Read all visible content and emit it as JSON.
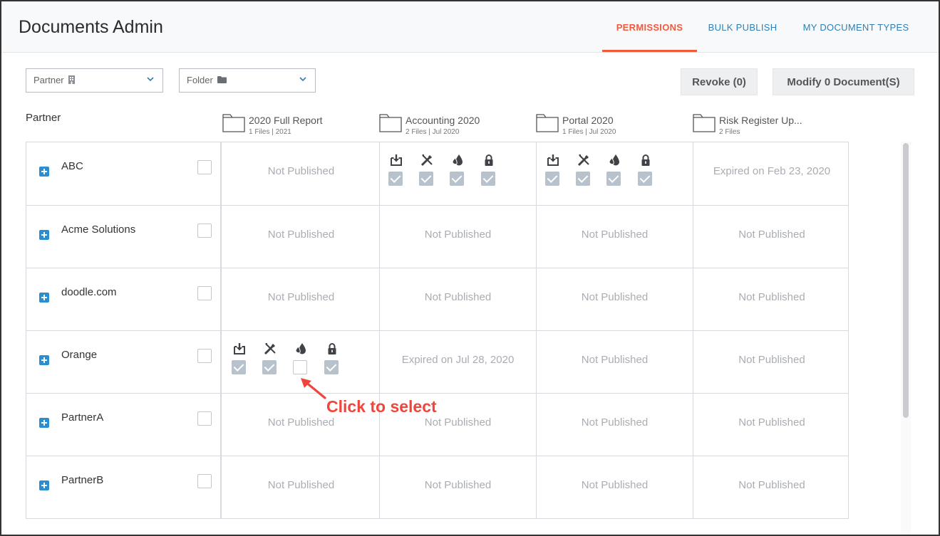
{
  "app": {
    "title": "Documents Admin"
  },
  "tabs": [
    {
      "label": "PERMISSIONS",
      "active": true
    },
    {
      "label": "BULK PUBLISH",
      "active": false
    },
    {
      "label": "MY DOCUMENT TYPES",
      "active": false
    }
  ],
  "filters": {
    "partner_label": "Partner",
    "partner_icon": "building-icon",
    "folder_label": "Folder",
    "folder_icon": "folder-icon"
  },
  "actions": {
    "revoke_label": "Revoke (0)",
    "modify_label": "Modify 0 Document(S)"
  },
  "grid": {
    "partner_header": "Partner",
    "columns": [
      {
        "name": "2020 Full Report",
        "sub": "1 Files | 2021"
      },
      {
        "name": "Accounting 2020",
        "sub": "2 Files | Jul 2020"
      },
      {
        "name": "Portal 2020",
        "sub": "1 Files | Jul 2020"
      },
      {
        "name": "Risk Register Up...",
        "sub": "2 Files"
      }
    ],
    "permission_icons": [
      "download-icon",
      "edit-tools-icon",
      "watermark-drop-icon",
      "lock-icon"
    ],
    "rows": [
      {
        "partner": "ABC",
        "cells": [
          {
            "status": "Not Published"
          },
          {
            "permissions": [
              true,
              true,
              true,
              true
            ]
          },
          {
            "permissions": [
              true,
              true,
              true,
              true
            ]
          },
          {
            "status": "Expired on Feb 23, 2020"
          }
        ]
      },
      {
        "partner": "Acme Solutions",
        "cells": [
          {
            "status": "Not Published"
          },
          {
            "status": "Not Published"
          },
          {
            "status": "Not Published"
          },
          {
            "status": "Not Published"
          }
        ]
      },
      {
        "partner": "doodle.com",
        "cells": [
          {
            "status": "Not Published"
          },
          {
            "status": "Not Published"
          },
          {
            "status": "Not Published"
          },
          {
            "status": "Not Published"
          }
        ]
      },
      {
        "partner": "Orange",
        "cells": [
          {
            "permissions": [
              true,
              true,
              false,
              true
            ]
          },
          {
            "status": "Expired on Jul 28, 2020"
          },
          {
            "status": "Not Published"
          },
          {
            "status": "Not Published"
          }
        ]
      },
      {
        "partner": "PartnerA",
        "cells": [
          {
            "status": "Not Published"
          },
          {
            "status": "Not Published"
          },
          {
            "status": "Not Published"
          },
          {
            "status": "Not Published"
          }
        ]
      },
      {
        "partner": "PartnerB",
        "cells": [
          {
            "status": "Not Published"
          },
          {
            "status": "Not Published"
          },
          {
            "status": "Not Published"
          },
          {
            "status": "Not Published"
          }
        ]
      }
    ]
  },
  "annotation": {
    "text": "Click to select",
    "color": "#f0453a"
  },
  "colors": {
    "accent": "#ef5a3c",
    "link": "#2d7fb5",
    "expand": "#2a8fd0"
  }
}
